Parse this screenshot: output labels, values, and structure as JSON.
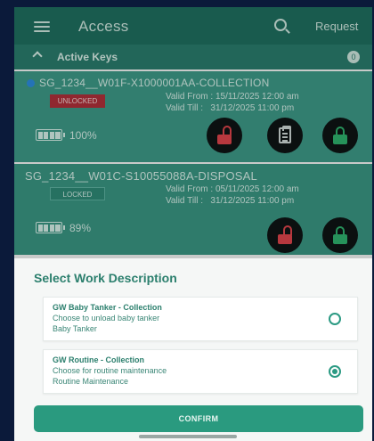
{
  "appbar": {
    "title": "Access",
    "request_label": "Request",
    "search_icon": "search-icon",
    "menu_icon": "menu-icon"
  },
  "section": {
    "title": "Active Keys",
    "count": "0"
  },
  "keys": [
    {
      "name": "SG_1234__W01F-X1000001AA-COLLECTION",
      "status": "UNLOCKED",
      "valid_from_label": "Valid From :",
      "valid_from": "15/11/2025 12:00 am",
      "valid_till_label": "Valid Till :",
      "valid_till": "31/12/2025 11:00 pm",
      "battery": "100%",
      "battery_level": 100,
      "status_color": "#b0303a"
    },
    {
      "name": "SG_1234__W01C-S10055088A-DISPOSAL",
      "status": "LOCKED",
      "valid_from_label": "Valid From :",
      "valid_from": "05/11/2025 12:00 am",
      "valid_till_label": "Valid Till :",
      "valid_till": "31/12/2025 11:00 pm",
      "battery": "89%",
      "battery_level": 89
    }
  ],
  "sheet": {
    "title": "Select Work Description",
    "options": [
      {
        "title": "GW Baby Tanker - Collection",
        "subtitle": "Choose to unload baby tanker",
        "description": "Baby Tanker",
        "selected": false
      },
      {
        "title": "GW Routine - Collection",
        "subtitle": "Choose for routine maintenance",
        "description": "Routine Maintenance",
        "selected": true
      }
    ],
    "confirm_label": "CONFIRM"
  },
  "colors": {
    "primary": "#1f6f60",
    "accent": "#2a9a7f",
    "unlock_red": "#e0454c",
    "lock_green": "#2fb36e"
  }
}
